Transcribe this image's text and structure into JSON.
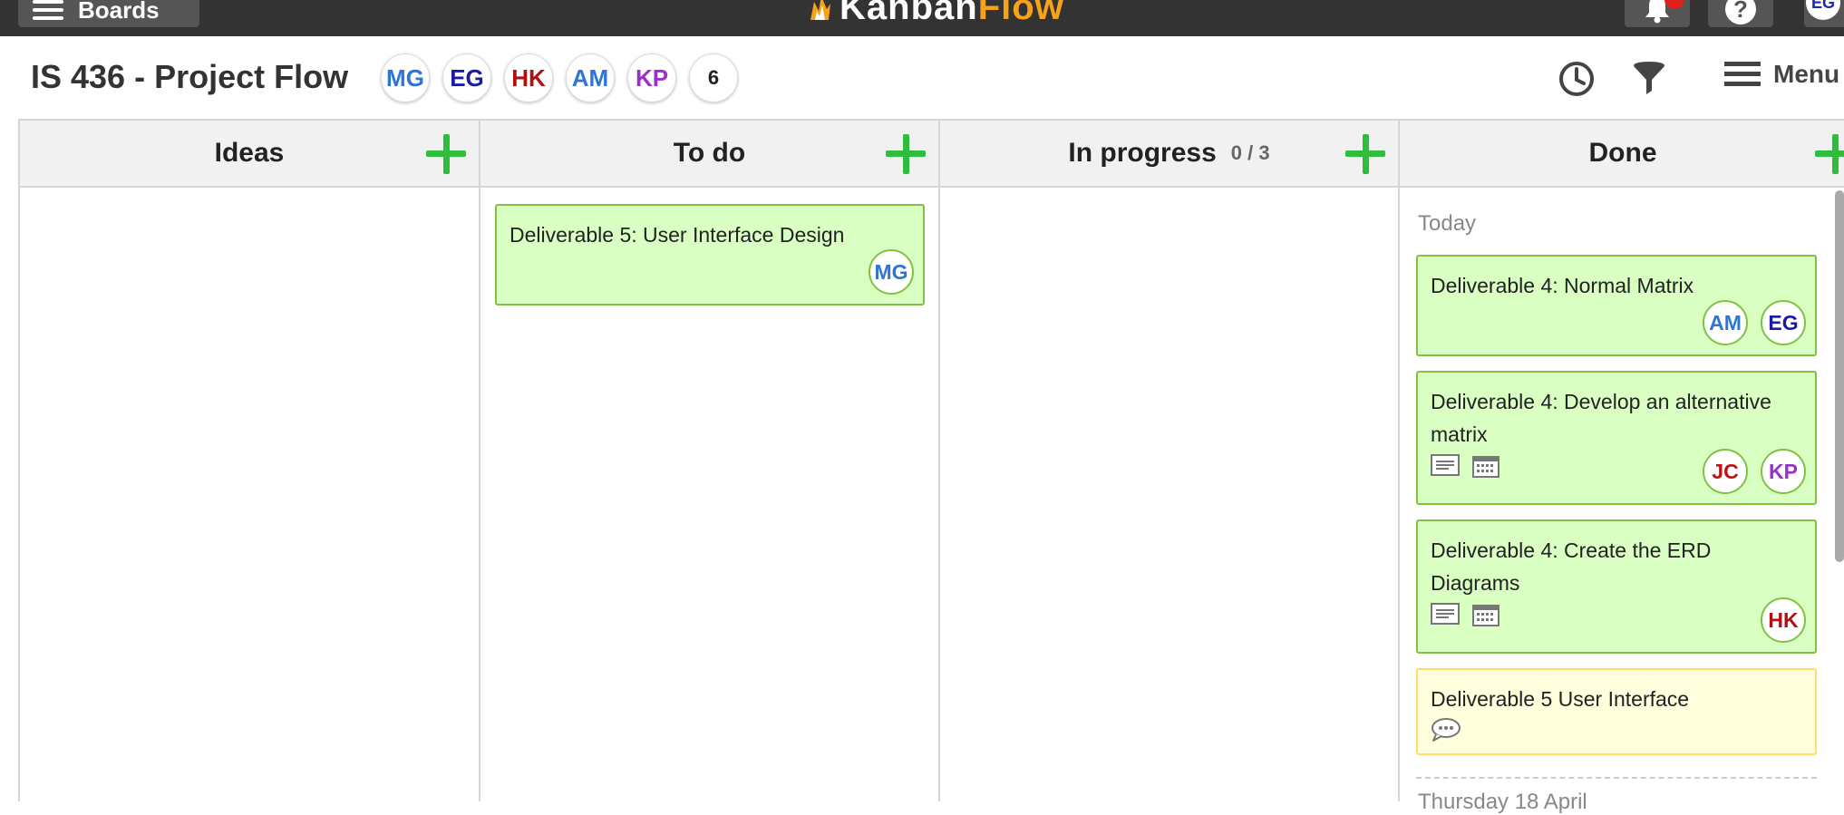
{
  "topbar": {
    "boards_label": "Boards",
    "brand_part1": "Kanban",
    "brand_part2": "Flow",
    "user_initials": "EG"
  },
  "header": {
    "title": "IS 436 - Project Flow",
    "members": [
      {
        "initials": "MG",
        "color": "#2e76d6"
      },
      {
        "initials": "EG",
        "color": "#1a1aa8"
      },
      {
        "initials": "HK",
        "color": "#b01010"
      },
      {
        "initials": "AM",
        "color": "#2e76d6"
      },
      {
        "initials": "KP",
        "color": "#9b2fc9"
      }
    ],
    "more_count": "6",
    "menu_label": "Menu"
  },
  "columns": [
    {
      "name": "Ideas",
      "wip": ""
    },
    {
      "name": "To do",
      "wip": ""
    },
    {
      "name": "In progress",
      "wip": "0 / 3"
    },
    {
      "name": "Done",
      "wip": ""
    }
  ],
  "todo_cards": [
    {
      "title": "Deliverable 5: User Interface Design",
      "assignees": [
        "MG"
      ]
    }
  ],
  "done": {
    "group_today": "Today",
    "cards": [
      {
        "title": "Deliverable 4: Normal Matrix",
        "assignees": [
          "AM",
          "EG"
        ],
        "color": "green"
      },
      {
        "title": "Deliverable 4: Develop an alternative matrix",
        "assignees": [
          "JC",
          "KP"
        ],
        "color": "green"
      },
      {
        "title": "Deliverable 4: Create the ERD Diagrams",
        "assignees": [
          "HK"
        ],
        "color": "green"
      },
      {
        "title": "Deliverable 5 User Interface",
        "assignees": [],
        "color": "yellow"
      }
    ],
    "next_group_partial": "Thursday 18 April"
  },
  "initial_colors": {
    "MG": "#2e76d6",
    "EG": "#1a1aa8",
    "HK": "#b01010",
    "AM": "#2e76d6",
    "KP": "#9b2fc9",
    "JC": "#c01010"
  }
}
